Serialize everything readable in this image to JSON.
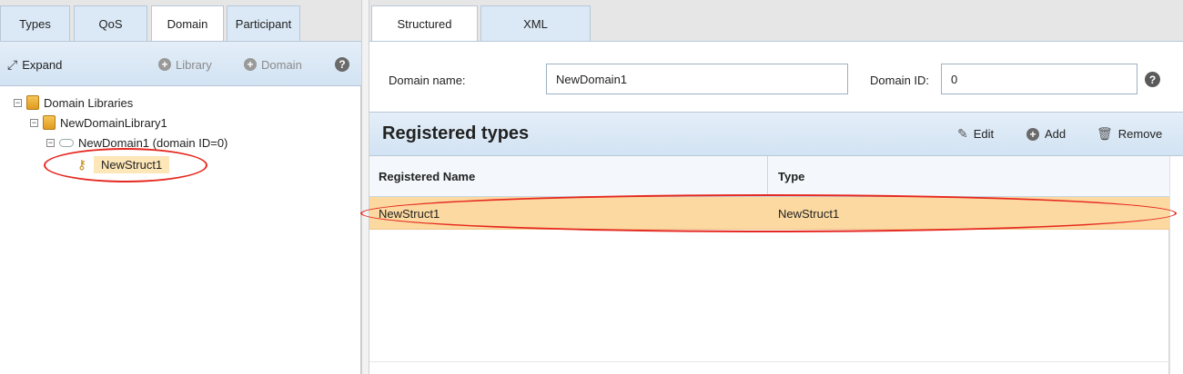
{
  "left_tabs": [
    "Types",
    "QoS",
    "Domain",
    "Participant"
  ],
  "left_toolbar": {
    "expand": "Expand",
    "library": "Library",
    "domain": "Domain",
    "help": "?"
  },
  "tree": {
    "root": "Domain Libraries",
    "library": "NewDomainLibrary1",
    "domain": "NewDomain1 (domain ID=0)",
    "struct": "NewStruct1"
  },
  "right_tabs": [
    "Structured",
    "XML"
  ],
  "form": {
    "domain_name_label": "Domain name:",
    "domain_name_value": "NewDomain1",
    "domain_id_label": "Domain ID:",
    "domain_id_value": "0",
    "help": "?"
  },
  "registered_types": {
    "title": "Registered types",
    "edit": "Edit",
    "add": "Add",
    "remove": "Remove",
    "columns": [
      "Registered Name",
      "Type"
    ],
    "rows": [
      {
        "name": "NewStruct1",
        "type": "NewStruct1"
      }
    ]
  },
  "colors": {
    "selection": "#fcd9a0",
    "highlight_ring": "#e5281f",
    "toolbar": "#dbe9f6"
  }
}
